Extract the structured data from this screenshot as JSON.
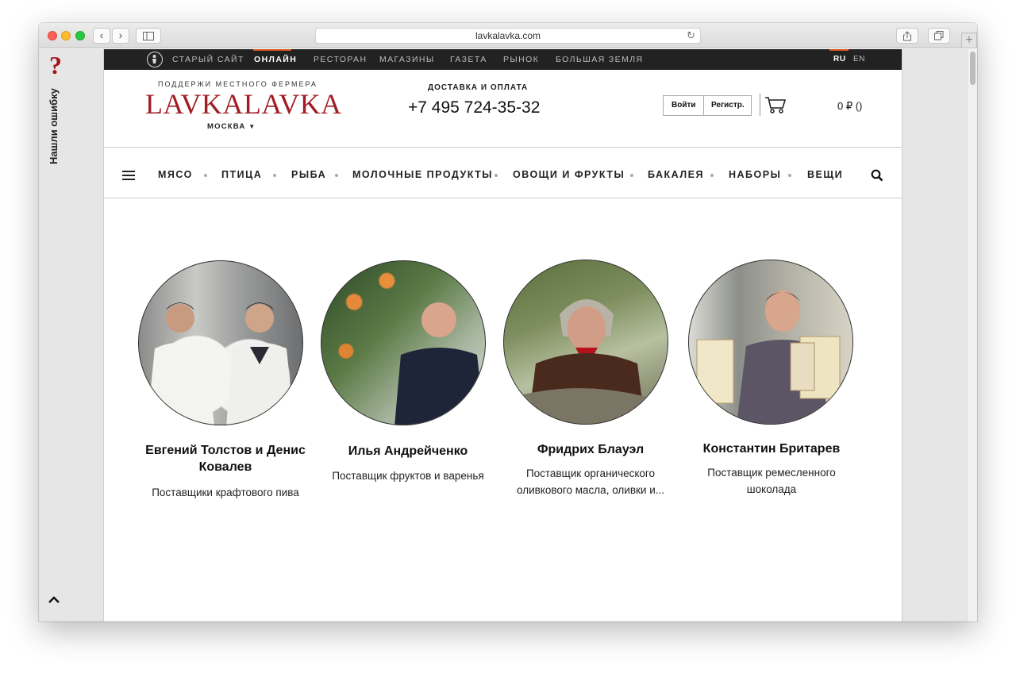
{
  "browser": {
    "url": "lavkalavka.com"
  },
  "feedback": {
    "label": "Нашли ошибку"
  },
  "topbar": {
    "items": [
      {
        "label": "СТАРЫЙ САЙТ"
      },
      {
        "label": "ОНЛАЙН",
        "active": true
      },
      {
        "label": "РЕСТОРАН"
      },
      {
        "label": "МАГАЗИНЫ"
      },
      {
        "label": "ГАЗЕТА"
      },
      {
        "label": "РЫНОК"
      },
      {
        "label": "БОЛЬШАЯ ЗЕМЛЯ"
      }
    ],
    "lang_ru": "RU",
    "lang_en": "EN"
  },
  "header": {
    "tagline": "ПОДДЕРЖИ МЕСТНОГО ФЕРМЕРА",
    "brand": "LAVKALAVKA",
    "city": "МОСКВА",
    "delivery": "ДОСТАВКА И ОПЛАТА",
    "phone": "+7 495 724-35-32",
    "login": "Войти",
    "register": "Регистр.",
    "cart_total": "0 ₽ ()"
  },
  "menu": {
    "items": [
      "МЯСО",
      "ПТИЦА",
      "РЫБА",
      "МОЛОЧНЫЕ ПРОДУКТЫ",
      "ОВОЩИ И ФРУКТЫ",
      "БАКАЛЕЯ",
      "НАБОРЫ",
      "ВЕЩИ"
    ]
  },
  "suppliers": [
    {
      "name": "Евгений Толстов и Денис Ковалев",
      "desc": "Поставщики крафтового пива"
    },
    {
      "name": "Илья Андрейченко",
      "desc": "Поставщик фруктов и варенья"
    },
    {
      "name": "Фридрих Блауэл",
      "desc": "Поставщик органического оливкового масла, оливки и..."
    },
    {
      "name": "Константин Бритарев",
      "desc": "Поставщик ремесленного шоколада"
    }
  ],
  "colors": {
    "brand_red": "#a11d24",
    "active_orange": "#d9541e",
    "topbar_bg": "#222222"
  }
}
